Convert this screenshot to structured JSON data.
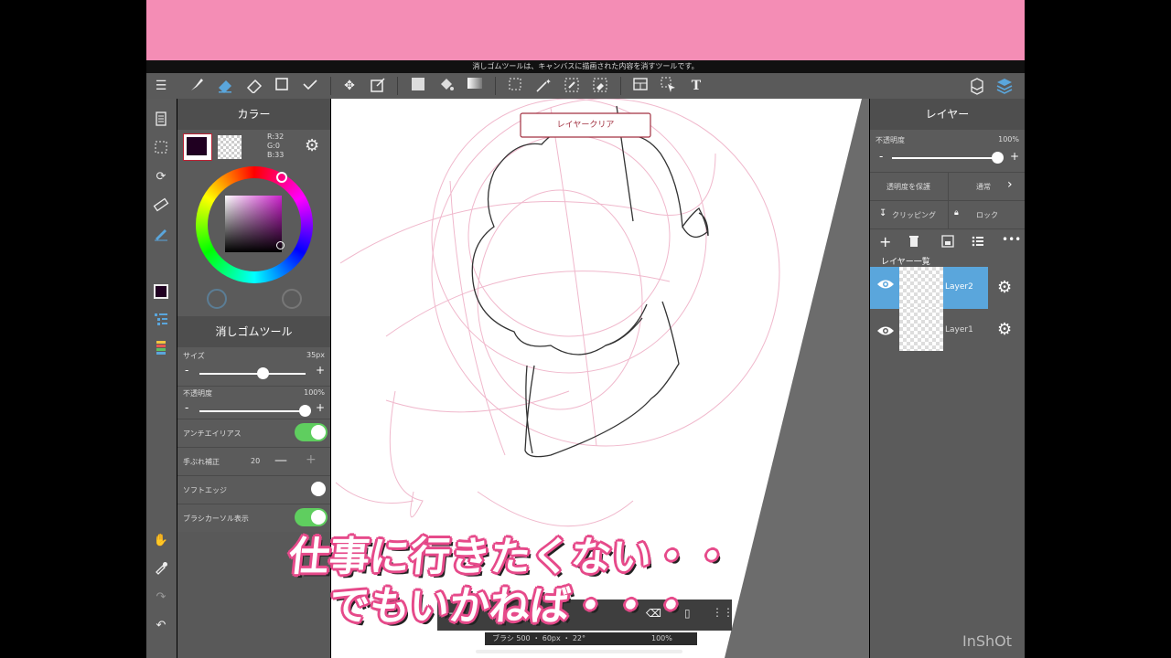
{
  "status_message": "消しゴムツールは、キャンバスに描画された内容を消すツールです。",
  "toolbar": {
    "tools": [
      "brush",
      "eraser",
      "fill-eraser",
      "shape",
      "vertex",
      "move",
      "transform",
      "fill-color",
      "bucket",
      "gradient",
      "select",
      "magic-wand",
      "select-pen",
      "select-eraser",
      "frame",
      "operation",
      "text"
    ],
    "right_icons": [
      "materials",
      "layers"
    ]
  },
  "color_panel": {
    "title": "カラー",
    "rgb": {
      "r": "R:32",
      "g": "G:0",
      "b": "B:33"
    },
    "primary_color": "#200021",
    "hue_color": "#cc22cc"
  },
  "tool_panel": {
    "title": "消しゴムツール",
    "size_label": "サイズ",
    "size_value": "35px",
    "size_level": 0.6,
    "opacity_label": "不透明度",
    "opacity_value": "100%",
    "opacity_level": 1.0,
    "antialias_label": "アンチエイリアス",
    "antialias_on": true,
    "stabilizer_label": "手ぶれ補正",
    "stabilizer_value": "20",
    "soft_edge_label": "ソフトエッジ",
    "soft_edge_on": false,
    "brush_cursor_label": "ブラシカーソル表示",
    "brush_cursor_on": true
  },
  "canvas": {
    "clear_button_label": "レイヤークリア"
  },
  "layer_panel": {
    "title": "レイヤー",
    "opacity_label": "不透明度",
    "opacity_value": "100%",
    "protect_alpha_label": "透明度を保護",
    "blend_mode_label": "通常",
    "clipping_label": "クリッピング",
    "lock_label": "ロック",
    "list_title": "レイヤー一覧",
    "layers": [
      {
        "name": "Layer2",
        "selected": true
      },
      {
        "name": "Layer1",
        "selected": false
      }
    ]
  },
  "bottom_bar": {
    "info_text": "ブラシ 500 ・ 60px ・ 22°",
    "zoom_text": "100%"
  },
  "captions": {
    "line1": "仕事に行きたくない・・",
    "line2": "でもいかねば・・・"
  },
  "watermark": "InShOt",
  "colors": {
    "accent_blue": "#5aa6dc",
    "toggle_green": "#5fce5f",
    "pink_bar": "#f48db5",
    "clear_border": "#a23040"
  }
}
